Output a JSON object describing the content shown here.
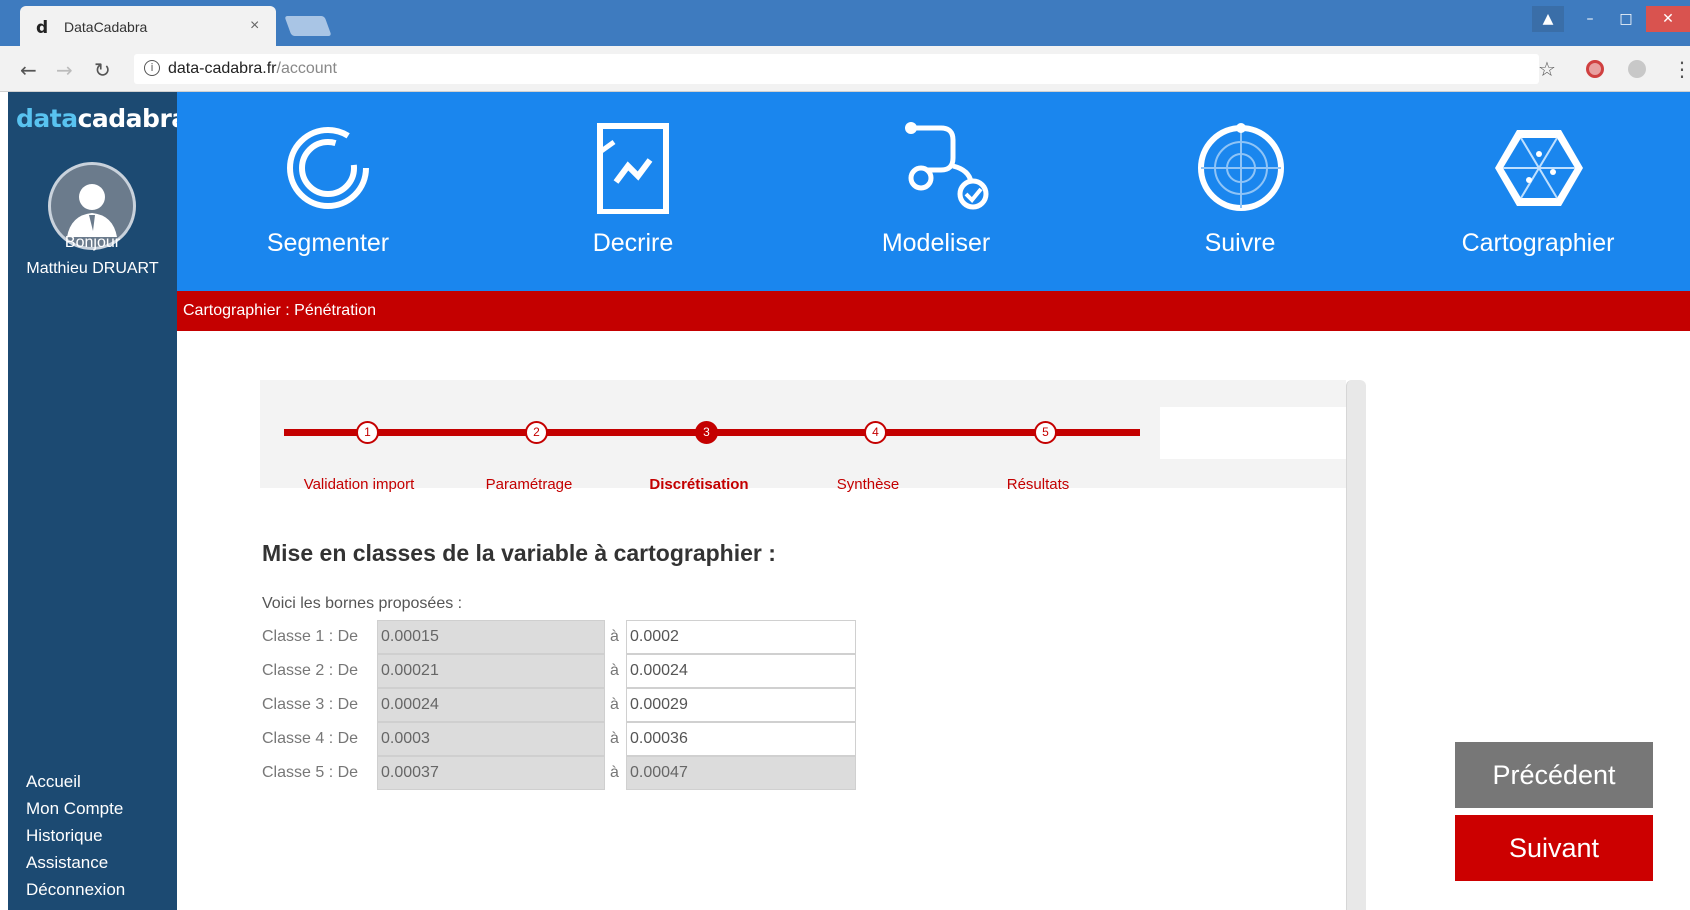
{
  "browser": {
    "tab_title": "DataCadabra",
    "favicon": "d",
    "tab_close": "×",
    "url_host": "data-cadabra.fr",
    "url_path": "/account"
  },
  "sidebar": {
    "logo_part1": "data",
    "logo_part2": "cadabra",
    "greeting": "Bonjour",
    "user_name": "Matthieu DRUART",
    "menu": [
      "Accueil",
      "Mon Compte",
      "Historique",
      "Assistance",
      "Déconnexion"
    ]
  },
  "topnav": {
    "items": [
      {
        "label": "Segmenter",
        "icon": "segment-ring-icon"
      },
      {
        "label": "Decrire",
        "icon": "document-chart-icon"
      },
      {
        "label": "Modeliser",
        "icon": "model-path-icon"
      },
      {
        "label": "Suivre",
        "icon": "radar-icon"
      },
      {
        "label": "Cartographier",
        "icon": "map-hexagon-icon"
      }
    ]
  },
  "breadcrumb": "Cartographier : Pénétration",
  "stepper": {
    "steps": [
      {
        "num": "1",
        "label": "Validation import"
      },
      {
        "num": "2",
        "label": "Paramétrage"
      },
      {
        "num": "3",
        "label": "Discrétisation"
      },
      {
        "num": "4",
        "label": "Synthèse"
      },
      {
        "num": "5",
        "label": "Résultats"
      }
    ],
    "active_step": 3
  },
  "content": {
    "title": "Mise en classes de la variable à cartographier :",
    "intro": "Voici les bornes proposées :",
    "separator": "à",
    "classes": [
      {
        "label": "Classe 1 : De",
        "from": "0.00015",
        "to": "0.0002"
      },
      {
        "label": "Classe 2 : De",
        "from": "0.00021",
        "to": "0.00024"
      },
      {
        "label": "Classe 3 : De",
        "from": "0.00024",
        "to": "0.00029"
      },
      {
        "label": "Classe 4 : De",
        "from": "0.0003",
        "to": "0.00036"
      },
      {
        "label": "Classe 5 : De",
        "from": "0.00037",
        "to": "0.00047"
      }
    ]
  },
  "buttons": {
    "prev": "Précédent",
    "next": "Suivant"
  },
  "colors": {
    "nav_blue": "#1a86ee",
    "sidebar_navy": "#1c4a72",
    "accent_red": "#c40000"
  }
}
